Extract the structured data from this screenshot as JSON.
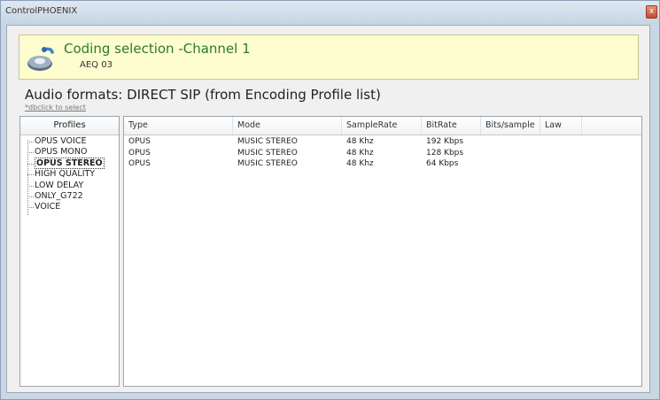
{
  "window": {
    "title": "ControlPHOENIX",
    "close_label": "x"
  },
  "banner": {
    "title": "Coding selection -Channel 1",
    "subtitle": "AEQ 03"
  },
  "formats": {
    "title": "Audio formats: DIRECT SIP (from Encoding Profile list)",
    "hint": "*dbclick to select"
  },
  "profiles": {
    "header": "Profiles",
    "items": [
      {
        "label": "OPUS VOICE",
        "selected": false
      },
      {
        "label": "OPUS MONO",
        "selected": false
      },
      {
        "label": "OPUS STEREO",
        "selected": true
      },
      {
        "label": "HIGH QUALITY",
        "selected": false
      },
      {
        "label": "LOW DELAY",
        "selected": false
      },
      {
        "label": "ONLY_G722",
        "selected": false
      },
      {
        "label": "VOICE",
        "selected": false
      }
    ]
  },
  "table": {
    "columns": [
      "Type",
      "Mode",
      "SampleRate",
      "BitRate",
      "Bits/sample",
      "Law"
    ],
    "rows": [
      [
        "OPUS",
        "MUSIC STEREO",
        "48 Khz",
        "192 Kbps",
        "",
        ""
      ],
      [
        "OPUS",
        "MUSIC STEREO",
        "48 Khz",
        "128 Kbps",
        "",
        ""
      ],
      [
        "OPUS",
        "MUSIC STEREO",
        "48 Khz",
        "64 Kbps",
        "",
        ""
      ]
    ]
  },
  "colors": {
    "banner_bg": "#fdfdcf",
    "banner_title": "#2d7a2d",
    "window_frame": "#c9d6e4"
  },
  "icons": {
    "banner": "audio-codec-icon",
    "close": "close-icon"
  }
}
